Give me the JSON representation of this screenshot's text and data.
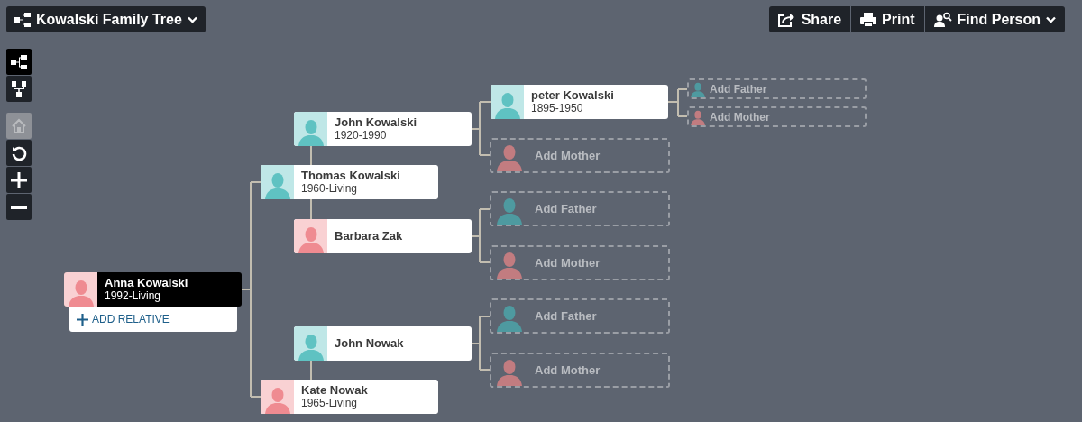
{
  "tree_menu": {
    "title": "Kowalski Family Tree"
  },
  "actions": [
    {
      "label": "Share"
    },
    {
      "label": "Print"
    },
    {
      "label": "Find Person",
      "dropdown": true
    }
  ],
  "view_modes": [
    {
      "selected": true
    },
    {
      "selected": false
    }
  ],
  "map_controls": [
    {
      "disabled": true
    },
    {
      "disabled": false
    },
    {
      "disabled": false
    },
    {
      "disabled": false
    }
  ],
  "tree": {
    "kind": "person",
    "name": "Anna Kowalski",
    "dates": "1992-Living",
    "color": "#ef8b91",
    "selected": true,
    "add_relative": "ADD RELATIVE",
    "parents": [
      {
        "kind": "person",
        "name": "Thomas Kowalski",
        "dates": "1960-Living",
        "color": "#5fc2c2",
        "selected": false,
        "parents": [
          {
            "kind": "person",
            "name": "John Kowalski",
            "dates": "1920-1990",
            "color": "#5fc2c2",
            "selected": false,
            "parents": [
              {
                "kind": "person",
                "name": "peter Kowalski",
                "dates": "1895-1950",
                "color": "#5fc2c2",
                "selected": false,
                "parents": [
                  {
                    "kind": "placeholder_small",
                    "label": "Add Father",
                    "color": "#4e9aa0"
                  },
                  {
                    "kind": "placeholder_small",
                    "label": "Add Mother",
                    "color": "#c27c80"
                  }
                ]
              },
              {
                "kind": "placeholder",
                "label": "Add Mother",
                "color": "#c27c80"
              }
            ]
          },
          {
            "kind": "person",
            "name": "Barbara Zak",
            "color": "#ef8b91",
            "selected": false,
            "parents": [
              {
                "kind": "placeholder",
                "label": "Add Father",
                "color": "#4e9aa0"
              },
              {
                "kind": "placeholder",
                "label": "Add Mother",
                "color": "#c27c80"
              }
            ]
          }
        ]
      },
      {
        "kind": "person",
        "name": "Kate Nowak",
        "dates": "1965-Living",
        "color": "#ef8b91",
        "selected": false,
        "parents": [
          {
            "kind": "person",
            "name": "John Nowak",
            "color": "#5fc2c2",
            "selected": false,
            "parents": [
              {
                "kind": "placeholder",
                "label": "Add Father",
                "color": "#4e9aa0"
              },
              {
                "kind": "placeholder",
                "label": "Add Mother",
                "color": "#c27c80"
              }
            ]
          }
        ]
      }
    ]
  }
}
